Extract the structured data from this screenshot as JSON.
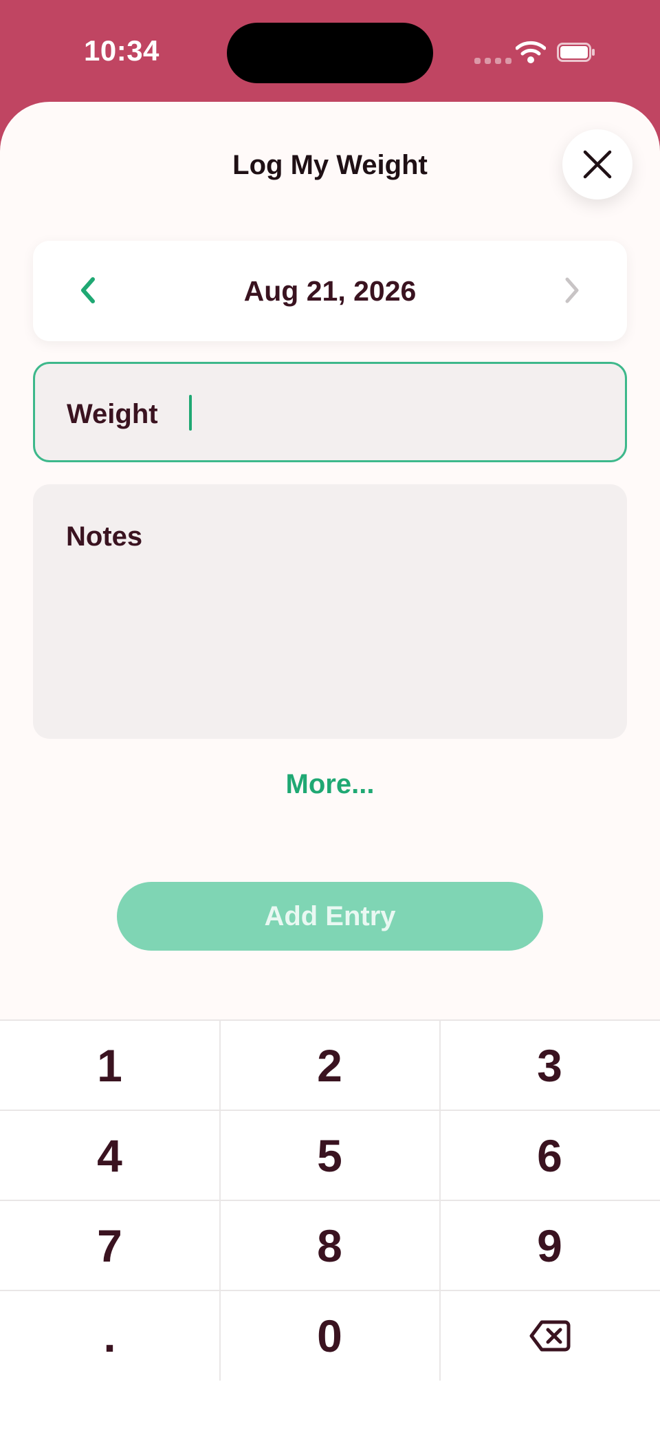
{
  "status_bar": {
    "time": "10:34",
    "icons": [
      "cellular-signal-icon",
      "wifi-icon",
      "battery-icon"
    ]
  },
  "sheet": {
    "title": "Log My Weight",
    "close_icon": "close-icon"
  },
  "date_picker": {
    "date": "Aug 21, 2026",
    "prev_icon": "chevron-left-icon",
    "next_icon": "chevron-right-icon"
  },
  "form": {
    "weight_label": "Weight",
    "weight_value": "",
    "notes_label": "Notes",
    "more_label": "More..."
  },
  "actions": {
    "add_entry_label": "Add Entry"
  },
  "keypad": {
    "rows": [
      [
        "1",
        "2",
        "3"
      ],
      [
        "4",
        "5",
        "6"
      ],
      [
        "7",
        "8",
        "9"
      ],
      [
        ".",
        "0",
        ""
      ]
    ],
    "delete_icon": "backspace-icon"
  },
  "colors": {
    "header_background": "#c04562",
    "sheet_background": "#fffaf9",
    "accent_green": "#1fa873",
    "focus_border": "#3db88b",
    "disabled_button": "#7fd5b4",
    "text_primary": "#3a1320"
  }
}
